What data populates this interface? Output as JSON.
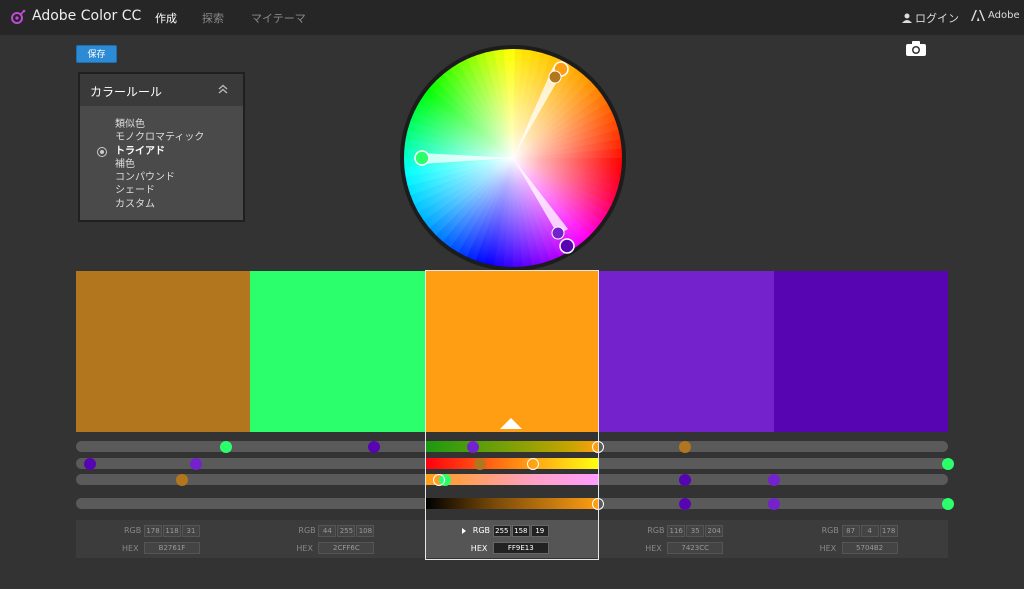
{
  "header": {
    "app_name": "Adobe Color CC",
    "nav": [
      "作成",
      "探索",
      "マイテーマ"
    ],
    "login_label": "ログイン",
    "adobe_label": "Adobe"
  },
  "toolbar": {
    "save_label": "保存"
  },
  "rules": {
    "title": "カラールール",
    "items": [
      "類似色",
      "モノクロマティック",
      "トライアド",
      "補色",
      "コンパウンド",
      "シェード",
      "カスタム"
    ],
    "selected": "トライアド"
  },
  "swatches": [
    {
      "hex": "B2761F",
      "rgb": [
        178,
        118,
        31
      ],
      "color": "#B2761F"
    },
    {
      "hex": "2CFF6C",
      "rgb": [
        44,
        255,
        108
      ],
      "color": "#2CFF6C"
    },
    {
      "hex": "FF9E13",
      "rgb": [
        255,
        158,
        19
      ],
      "color": "#FF9E13"
    },
    {
      "hex": "7423CC",
      "rgb": [
        116,
        35,
        204
      ],
      "color": "#7423CC"
    },
    {
      "hex": "5704B2",
      "rgb": [
        87,
        4,
        178
      ],
      "color": "#5704B2"
    }
  ],
  "selected_index": 2,
  "labels": {
    "rgb": "RGB",
    "hex": "HEX"
  },
  "colors": {
    "accent": "#2d8ad5",
    "background": "#333333",
    "topbar": "#262626"
  },
  "icons": [
    "adobe-color-logo-icon",
    "user-icon",
    "adobe-logo-icon",
    "camera-icon",
    "chevron-up-icon",
    "play-icon"
  ]
}
